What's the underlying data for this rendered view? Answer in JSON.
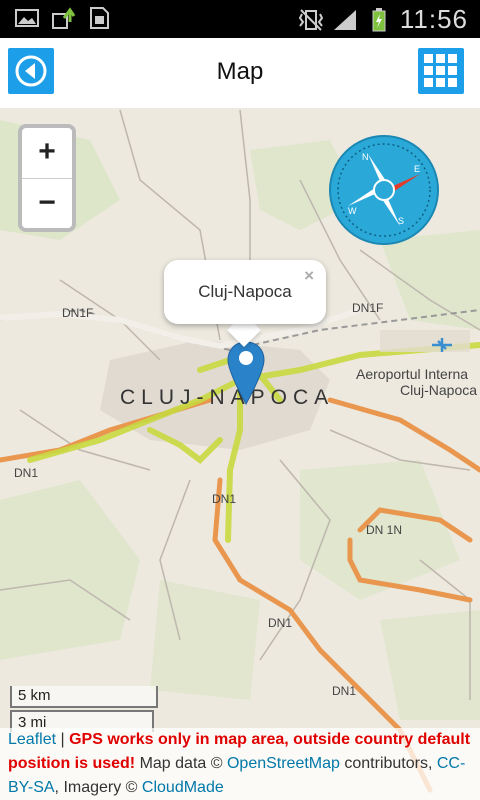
{
  "statusbar": {
    "time": "11:56",
    "left_icons": [
      "image-icon",
      "upload-icon",
      "sim-card-icon"
    ],
    "right_icons": [
      "vibrate-icon",
      "signal-icon",
      "battery-charging-icon"
    ]
  },
  "appbar": {
    "title": "Map",
    "back_icon": "back-arrow-icon",
    "grid_icon": "grid-icon",
    "accent": "#1d9ee8"
  },
  "map": {
    "zoom_in": "+",
    "zoom_out": "−",
    "compass_icon": "compass-icon",
    "popup": {
      "text": "Cluj-Napoca",
      "close": "×"
    },
    "marker_color": "#2a82c9",
    "labels": {
      "city": "CLUJ-NAPOCA",
      "airport_line1": "Aeroportul Interna",
      "airport_line2": "Cluj-Napoca",
      "dn1f": "DN1F",
      "dn1f_b": "DN1F",
      "dn1_a": "DN1",
      "dn1_b": "DN1",
      "dn1_c": "DN1",
      "dn1_d": "DN1",
      "dn1n": "DN 1N"
    },
    "scale": {
      "km": "5 km",
      "mi": "3 mi"
    }
  },
  "attribution": {
    "leaflet": "Leaflet",
    "sep": " | ",
    "warning": "GPS works only in map area, outside country default position is used!",
    "map_data": " Map data © ",
    "osm": "OpenStreetMap",
    "contributors": " contributors, ",
    "license": "CC-BY-SA",
    "imagery": ", Imagery © ",
    "cloudmade": "CloudMade"
  }
}
